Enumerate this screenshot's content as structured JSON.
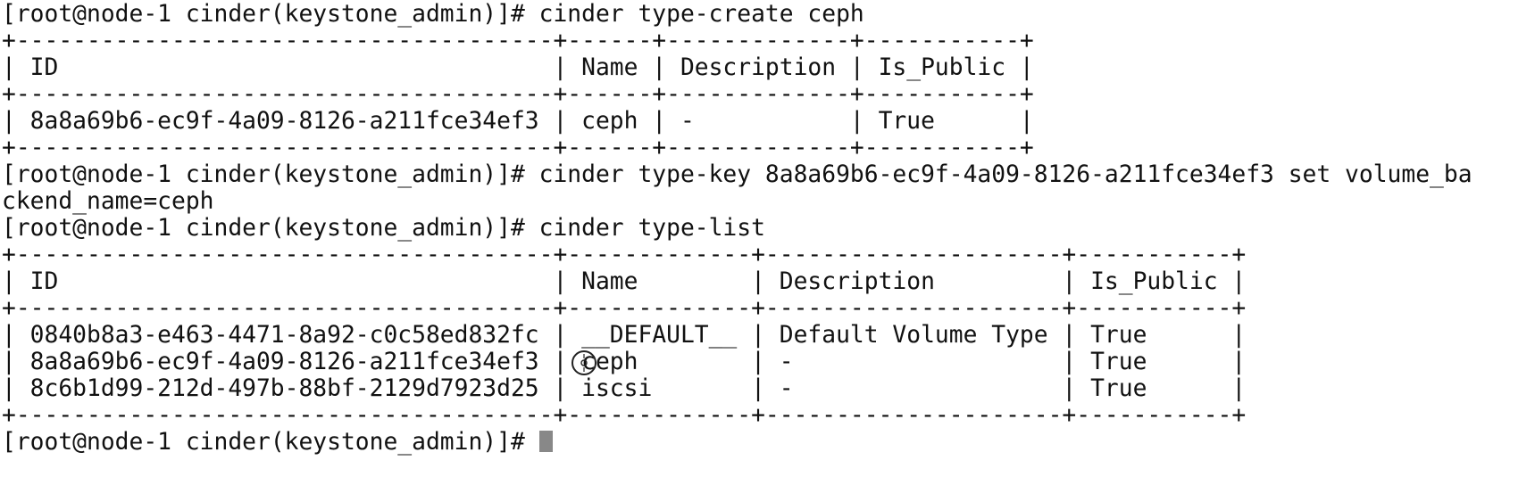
{
  "terminal": {
    "lines": [
      "[root@node-1 cinder(keystone_admin)]# cinder type-create ceph",
      "+--------------------------------------+------+-------------+-----------+",
      "| ID                                   | Name | Description | Is_Public |",
      "+--------------------------------------+------+-------------+-----------+",
      "| 8a8a69b6-ec9f-4a09-8126-a211fce34ef3 | ceph | -           | True      |",
      "+--------------------------------------+------+-------------+-----------+",
      "[root@node-1 cinder(keystone_admin)]# cinder type-key 8a8a69b6-ec9f-4a09-8126-a211fce34ef3 set volume_ba",
      "ckend_name=ceph",
      "[root@node-1 cinder(keystone_admin)]# cinder type-list",
      "+--------------------------------------+-------------+---------------------+-----------+",
      "| ID                                   | Name        | Description         | Is_Public |",
      "+--------------------------------------+-------------+---------------------+-----------+",
      "| 0840b8a3-e463-4471-8a92-c0c58ed832fc | __DEFAULT__ | Default Volume Type | True      |",
      "| 8a8a69b6-ec9f-4a09-8126-a211fce34ef3 | ceph        | -                   | True      |",
      "| 8c6b1d99-212d-497b-88bf-2129d7923d25 | iscsi       | -                   | True      |",
      "+--------------------------------------+-------------+---------------------+-----------+",
      "[root@node-1 cinder(keystone_admin)]# "
    ]
  },
  "icons": {
    "cursor": "text-cursor-block-icon",
    "pointer": "mouse-pointer-icon"
  },
  "colors": {
    "background": "#ffffff",
    "text": "#111111",
    "cursor": "#888888"
  }
}
